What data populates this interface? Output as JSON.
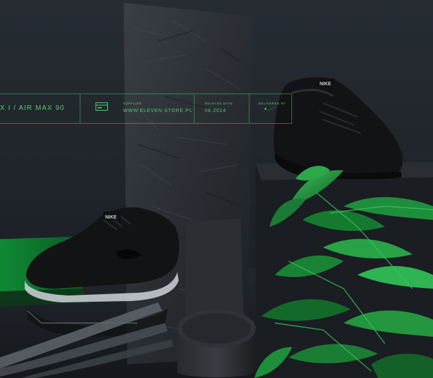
{
  "banner": {
    "title": "X I / AIR MAX 90",
    "supplier_label": "SUPPLIER",
    "supplier_value": "WWW.ELEVEN-STORE.PL",
    "release_label": "RELEASE DATE",
    "release_value": "08.2014",
    "delivered_label": "DELIVERED BY"
  },
  "product_text": {
    "tongue_logo_upper": "NIKE",
    "tongue_logo_lower": "NIKE"
  },
  "colors": {
    "accent_green": "#4fd06a",
    "background": "#1f242b",
    "shoe_black": "#121315"
  },
  "icons": {
    "card": "card-icon",
    "brand": "swoosh-icon"
  }
}
